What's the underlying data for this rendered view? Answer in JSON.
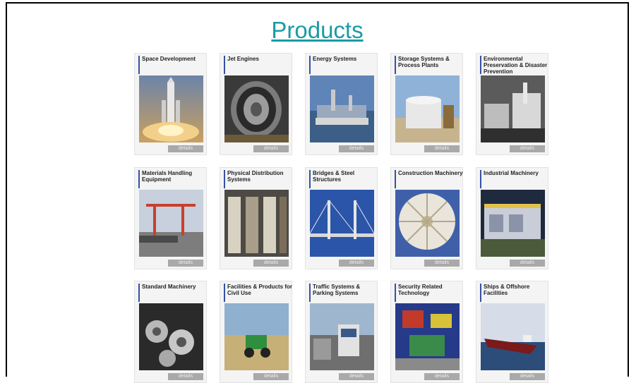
{
  "page": {
    "title": "Products"
  },
  "products": [
    {
      "label": "Space Development",
      "details": "details"
    },
    {
      "label": "Jet Engines",
      "details": "details"
    },
    {
      "label": "Energy Systems",
      "details": "details"
    },
    {
      "label": "Storage Systems & Process Plants",
      "details": "details"
    },
    {
      "label": "Environmental Preservation & Disaster Prevention",
      "details": "details"
    },
    {
      "label": "Materials Handling Equipment",
      "details": "details"
    },
    {
      "label": "Physical Distribution Systems",
      "details": "details"
    },
    {
      "label": "Bridges & Steel Structures",
      "details": "details"
    },
    {
      "label": "Construction Machinery",
      "details": "details"
    },
    {
      "label": "Industrial Machinery",
      "details": "details"
    },
    {
      "label": "Standard Machinery",
      "details": "details"
    },
    {
      "label": "Facilities & Products for Civil Use",
      "details": "details"
    },
    {
      "label": "Traffic Systems & Parking Systems",
      "details": "details"
    },
    {
      "label": "Security Related Technology",
      "details": "details"
    },
    {
      "label": "Ships & Offshore Facilities",
      "details": "details"
    }
  ]
}
